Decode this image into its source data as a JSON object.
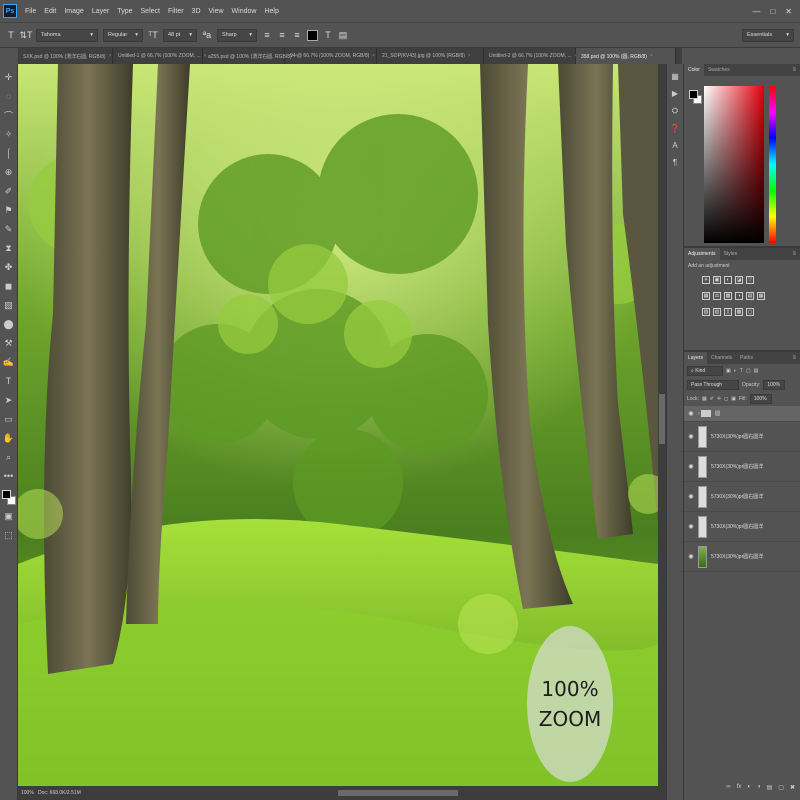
{
  "app": {
    "logo": "Ps"
  },
  "menu": [
    "File",
    "Edit",
    "Image",
    "Layer",
    "Type",
    "Select",
    "Filter",
    "3D",
    "View",
    "Window",
    "Help"
  ],
  "window_controls": [
    "—",
    "□",
    "✕"
  ],
  "options": {
    "tool_icon": "T",
    "orient_icon": "⇅T",
    "font_family": "Tahoma",
    "font_style": "Regular",
    "size_icon": "ᵀT",
    "font_size": "48 pt",
    "aa_icon": "ªa",
    "antialias": "Sharp",
    "align_icons": [
      "≡",
      "≡",
      "≡"
    ],
    "text_color": "#000000",
    "warp_icon": "T",
    "panels_icon": "▤",
    "workspace": "Essentials"
  },
  "tabs": [
    {
      "label": "SXK.psd @ 100% (渭洋右圆, RGB/8)",
      "active": false
    },
    {
      "label": "Untitled-1 @ 66.7% (100% ZOOM, ...",
      "active": false
    },
    {
      "label": "a255.psd @ 100% (渭洋右圆, RGB/8)",
      "active": false
    },
    {
      "label": "94 @ 66.7% (100% ZOOM, RGB/8)",
      "active": false
    },
    {
      "label": "21_SOP(KV43).jpg @ 100% (RGB/8)",
      "active": false
    },
    {
      "label": "Untitled-2 @ 66.7% (100% ZOOM, ...",
      "active": false
    },
    {
      "label": "358.psd @ 100% (圆, RGB/8)",
      "active": true
    }
  ],
  "tools": [
    "✛",
    "◌",
    "⌒",
    "✧",
    "⌠",
    "⊕",
    "✐",
    "⚑",
    "✎",
    "⧗",
    "✤",
    "◼",
    "▧",
    "⬤",
    "⚒",
    "✍",
    "T",
    "➤",
    "▭",
    "✋",
    "⌕",
    "•••"
  ],
  "tools_bottom": [
    "▣",
    "⬚"
  ],
  "panel_icons": [
    "▦",
    "▶",
    "⛭",
    "❓",
    "A",
    "¶"
  ],
  "color_panel": {
    "tabs": [
      "Color",
      "Swatches"
    ],
    "fg": "#000000",
    "bg": "#ffffff",
    "menu": "≡"
  },
  "adjustments_panel": {
    "tabs": [
      "Adjustments",
      "Styles"
    ],
    "label": "Add an adjustment",
    "rows": [
      [
        "☀",
        "▣",
        "◐",
        "◪",
        "▽"
      ],
      [
        "▦",
        "⚖",
        "▩",
        "◑",
        "▤",
        "▦"
      ],
      [
        "▧",
        "▨",
        "╳",
        "▩",
        "◻"
      ]
    ]
  },
  "layers_panel": {
    "tabs": [
      "Layers",
      "Channels",
      "Paths"
    ],
    "filter_kind": "Kind",
    "blend_mode": "Pass Through",
    "opacity_label": "Opacity:",
    "opacity_value": "100%",
    "lock_label": "Lock:",
    "lock_icons": [
      "▦",
      "✐",
      "✛",
      "◻",
      "▣"
    ],
    "fill_label": "Fill:",
    "fill_value": "100%",
    "layers": [
      {
        "name": "圆",
        "type": "group",
        "selected": true
      },
      {
        "name": "5730X(30%)pr圆右圆洋",
        "type": "text"
      },
      {
        "name": "5730X(30%)pr圆右圆洋",
        "type": "text"
      },
      {
        "name": "5730X(30%)pr圆右圆洋",
        "type": "text"
      },
      {
        "name": "5730X(30%)pr圆右圆洋",
        "type": "text"
      },
      {
        "name": "5730X(30%)pr圆右圆洋",
        "type": "image"
      }
    ],
    "footer_icons": [
      "∞",
      "fx",
      "◐",
      "◑",
      "▤",
      "▢",
      "✖"
    ]
  },
  "status": {
    "zoom": "100%",
    "doc": "Doc: 668.0K/2.51M"
  },
  "badge": {
    "line1": "100%",
    "line2": "ZOOM"
  }
}
